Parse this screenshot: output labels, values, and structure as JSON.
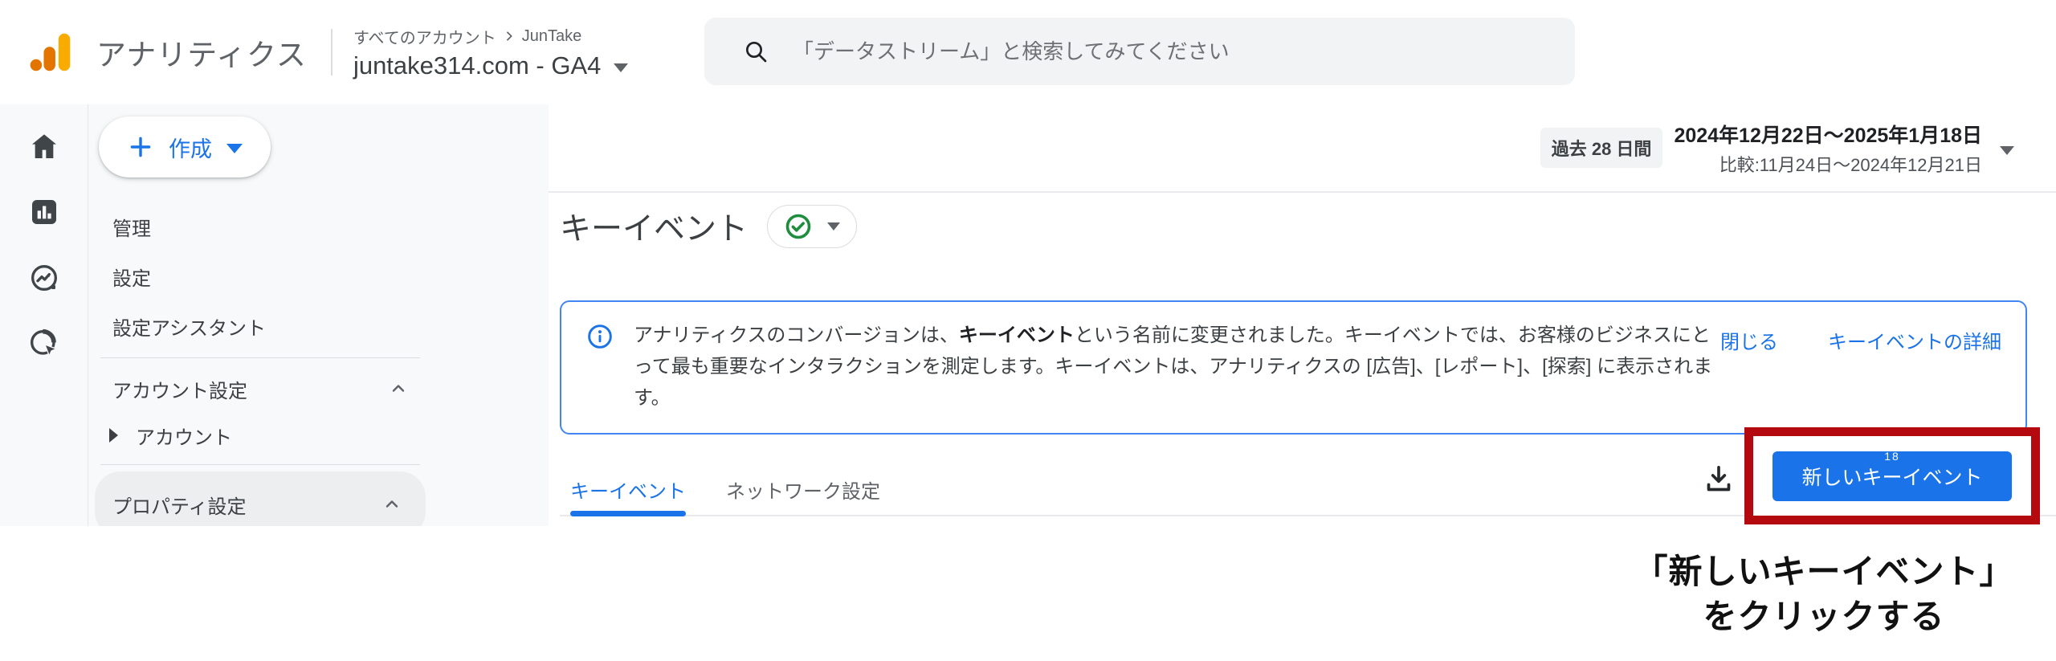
{
  "header": {
    "app_name": "アナリティクス",
    "breadcrumb_root": "すべてのアカウント",
    "breadcrumb_account": "JunTake",
    "property": "juntake314.com - GA4",
    "search_placeholder": "「データストリーム」と検索してみてください"
  },
  "sidebar": {
    "create_label": "作成",
    "items": [
      {
        "label": "管理"
      },
      {
        "label": "設定"
      },
      {
        "label": "設定アシスタント"
      }
    ],
    "account_section": "アカウント設定",
    "account_item": "アカウント",
    "property_section": "プロパティ設定"
  },
  "toolbar": {
    "range_chip": "過去 28 日間",
    "date_range": "2024年12月22日～2025年1月18日",
    "compare": "比較:11月24日～2024年12月21日"
  },
  "page": {
    "title": "キーイベント"
  },
  "banner": {
    "text_before_bold": "アナリティクスのコンバージョンは、",
    "text_bold": "キーイベント",
    "text_after_bold": "という名前に変更されました。キーイベントでは、お客様のビジネスにとって最も重要なインタラクションを測定します。キーイベントは、アナリティクスの [広告]、[レポート]、[探索] に表示されます。",
    "close_label": "閉じる",
    "details_label": "キーイベントの詳細"
  },
  "tabs": [
    {
      "label": "キーイベント"
    },
    {
      "label": "ネットワーク設定"
    }
  ],
  "new_key_event_button": {
    "pre": "新しいキ",
    "dash": "ー",
    "sup": "18",
    "post": "イベント"
  },
  "caption": {
    "line1": "「新しいキーイベント」",
    "line2": "をクリックする"
  },
  "icons": {
    "logo": "ga-bars",
    "rail": [
      "home",
      "reports-bar-chart",
      "explore-compass",
      "advertising-target"
    ],
    "search": "magnifier",
    "status": "check-circle-green",
    "banner": "info-circle-blue",
    "actions": "download-tray"
  },
  "colors": {
    "accent_blue": "#1a73e8",
    "annotation_red": "#b3090f",
    "logo_orange": "#f9ab00",
    "logo_dark_orange": "#e37400",
    "success_green": "#1e8e3e",
    "banner_border": "#4285f4",
    "sidebar_bg": "#f8f9fa"
  }
}
